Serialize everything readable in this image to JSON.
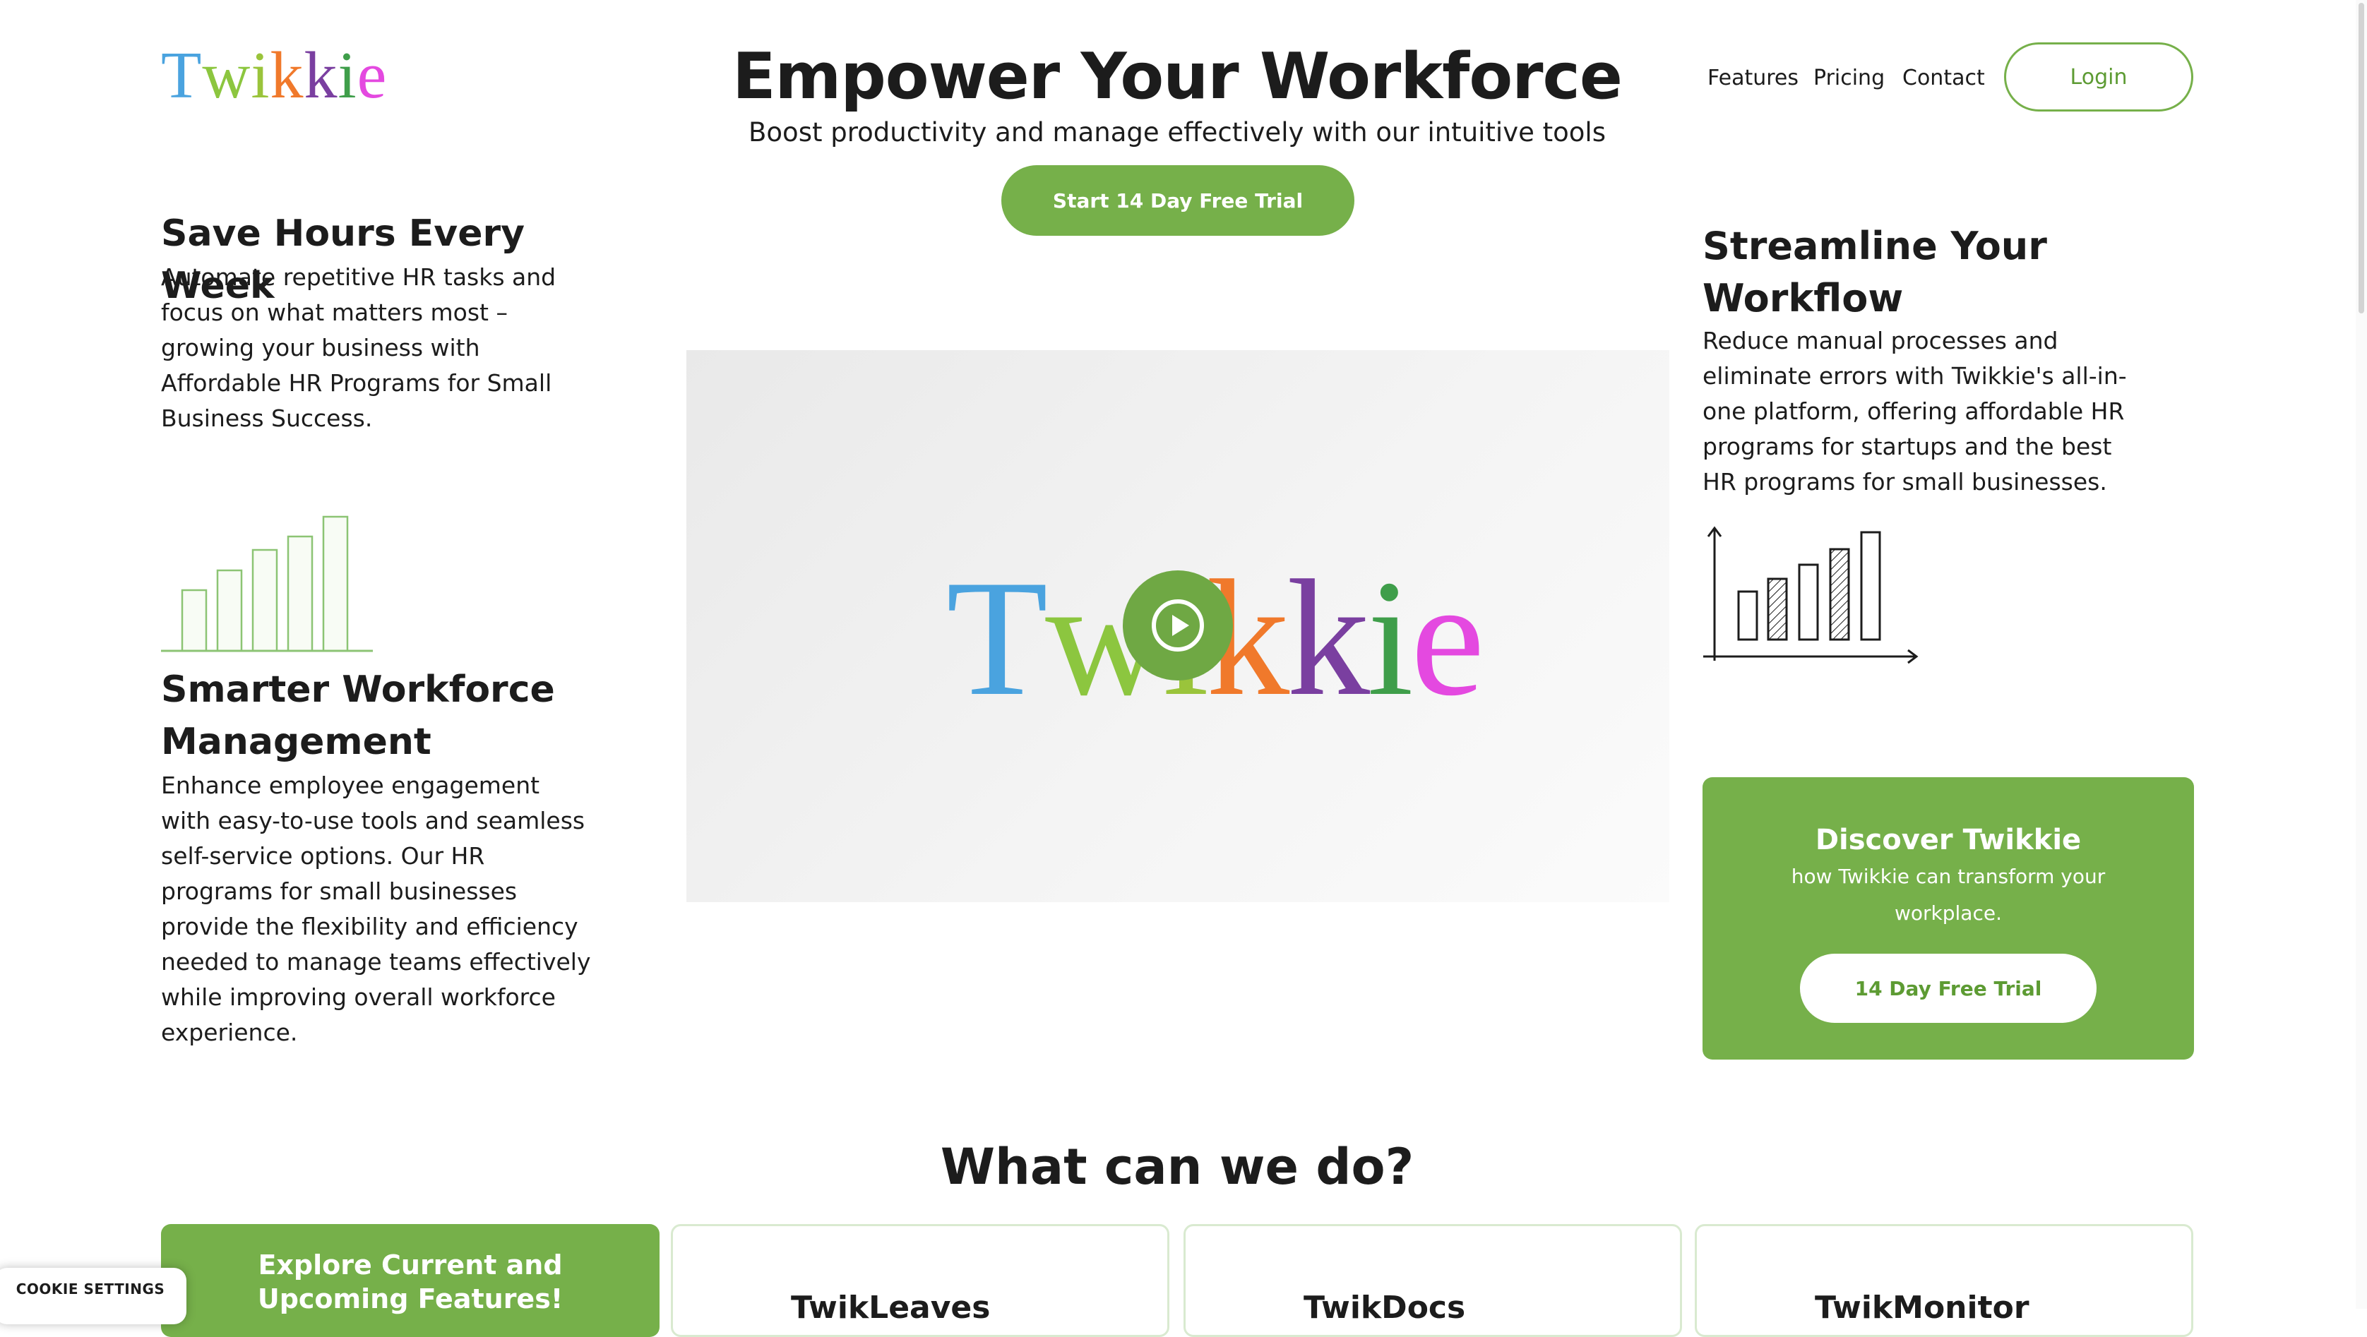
{
  "header": {
    "logo_letters": [
      {
        "char": "T",
        "color": "#4aa3df"
      },
      {
        "char": "w",
        "color": "#8cc63f"
      },
      {
        "char": "i",
        "color": "#9ac43b"
      },
      {
        "char": "k",
        "color": "#f0792b"
      },
      {
        "char": "k",
        "color": "#7a3fa0"
      },
      {
        "char": "i",
        "color": "#3f9e4a"
      },
      {
        "char": "e",
        "color": "#e449e0"
      }
    ],
    "nav": [
      "Features",
      "Pricing",
      "Contact"
    ],
    "login_label": "Login"
  },
  "hero": {
    "title": "Empower Your Workforce",
    "subtitle": "Boost productivity and manage effectively with our intuitive tools",
    "cta_label": "Start 14 Day Free Trial"
  },
  "left": {
    "block1_title": "Save Hours Every Week",
    "block1_lines": [
      "Automate repetitive HR tasks and",
      "focus on what matters most –",
      "growing your business with",
      "Affordable HR Programs for Small",
      "Business Success."
    ],
    "block2_title_lines": [
      "Smarter Workforce",
      "Management"
    ],
    "block2_lines": [
      "Enhance employee engagement",
      "with easy-to-use tools and seamless",
      "self-service options. Our HR",
      "programs for small businesses",
      "provide the flexibility and efficiency",
      "needed to manage teams effectively",
      "while improving overall workforce",
      "experience."
    ],
    "bar_icon_levels": [
      0.45,
      0.6,
      0.75,
      0.85,
      1.0
    ]
  },
  "right": {
    "title_lines": [
      "Streamline Your",
      "Workflow"
    ],
    "lines": [
      "Reduce manual processes and",
      "eliminate errors with Twikkie's all-in-",
      "one platform, offering affordable HR",
      "programs for startups and the best",
      "HR programs for small businesses."
    ]
  },
  "video": {
    "logo_letters": [
      {
        "char": "T",
        "color": "#4aa3df"
      },
      {
        "char": "w",
        "color": "#8cc63f"
      },
      {
        "char": "i",
        "color": "#9ac43b"
      },
      {
        "char": "k",
        "color": "#f0792b"
      },
      {
        "char": "k",
        "color": "#7a3fa0"
      },
      {
        "char": "i",
        "color": "#3f9e4a"
      },
      {
        "char": "e",
        "color": "#e449e0"
      }
    ]
  },
  "discover": {
    "title": "Discover Twikkie",
    "text": "how Twikkie can transform your workplace.",
    "button_label": "14 Day Free Trial"
  },
  "section": {
    "title": "What can we do?",
    "green_tile_label": "Explore Current and Upcoming Features!",
    "tiles": [
      "TwikLeaves",
      "TwikDocs",
      "TwikMonitor"
    ]
  },
  "cookie_label": "COOKIE SETTINGS",
  "colors": {
    "brand_green": "#76b04a",
    "text": "#1c1c1c"
  }
}
